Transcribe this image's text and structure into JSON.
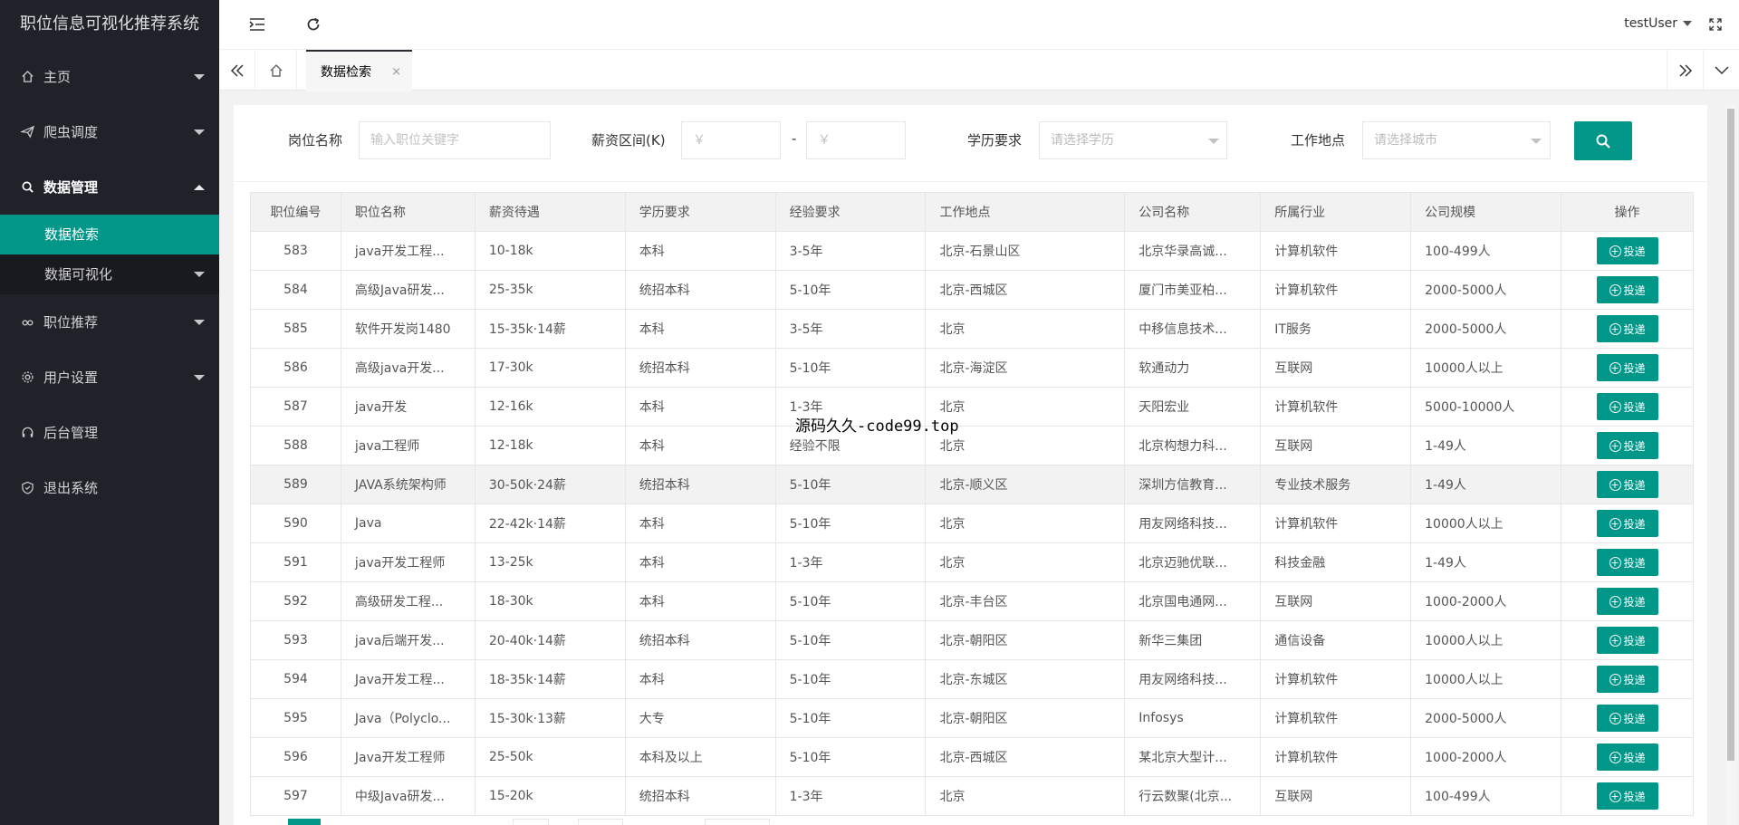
{
  "app": {
    "title": "职位信息可视化推荐系统"
  },
  "sidebar": {
    "items": [
      {
        "label": "主页",
        "icon": "home-icon"
      },
      {
        "label": "爬虫调度",
        "icon": "send-icon"
      },
      {
        "label": "数据管理",
        "icon": "search-icon",
        "open": true,
        "children": [
          {
            "label": "数据检索",
            "active": true
          },
          {
            "label": "数据可视化"
          }
        ]
      },
      {
        "label": "职位推荐",
        "icon": "link-icon"
      },
      {
        "label": "用户设置",
        "icon": "gear-icon"
      },
      {
        "label": "后台管理",
        "icon": "headset-icon"
      },
      {
        "label": "退出系统",
        "icon": "shield-icon"
      }
    ]
  },
  "header": {
    "user": "testUser"
  },
  "tabs": {
    "active_label": "数据检索",
    "close_glyph": "×"
  },
  "search": {
    "job_label": "岗位名称",
    "job_placeholder": "输入职位关键字",
    "salary_label": "薪资区间(K)",
    "salary_min_placeholder": "￥",
    "salary_max_placeholder": "￥",
    "salary_dash": "-",
    "edu_label": "学历要求",
    "edu_placeholder": "请选择学历",
    "city_label": "工作地点",
    "city_placeholder": "请选择城市"
  },
  "table": {
    "headers": [
      "职位编号",
      "职位名称",
      "薪资待遇",
      "学历要求",
      "经验要求",
      "工作地点",
      "公司名称",
      "所属行业",
      "公司规模",
      "操作"
    ],
    "action_label": "投递",
    "rows": [
      [
        "583",
        "java开发工程...",
        "10-18k",
        "本科",
        "3-5年",
        "北京-石景山区",
        "北京华录高诚...",
        "计算机软件",
        "100-499人"
      ],
      [
        "584",
        "高级Java研发...",
        "25-35k",
        "统招本科",
        "5-10年",
        "北京-西城区",
        "厦门市美亚柏...",
        "计算机软件",
        "2000-5000人"
      ],
      [
        "585",
        "软件开发岗1480",
        "15-35k·14薪",
        "本科",
        "3-5年",
        "北京",
        "中移信息技术...",
        "IT服务",
        "2000-5000人"
      ],
      [
        "586",
        "高级java开发...",
        "17-30k",
        "统招本科",
        "5-10年",
        "北京-海淀区",
        "软通动力",
        "互联网",
        "10000人以上"
      ],
      [
        "587",
        "java开发",
        "12-16k",
        "本科",
        "1-3年",
        "北京",
        "天阳宏业",
        "计算机软件",
        "5000-10000人"
      ],
      [
        "588",
        "java工程师",
        "12-18k",
        "本科",
        "经验不限",
        "北京",
        "北京构想力科...",
        "互联网",
        "1-49人"
      ],
      [
        "589",
        "JAVA系统架构师",
        "30-50k·24薪",
        "统招本科",
        "5-10年",
        "北京-顺义区",
        "深圳方信教育...",
        "专业技术服务",
        "1-49人"
      ],
      [
        "590",
        "Java",
        "22-42k·14薪",
        "本科",
        "5-10年",
        "北京",
        "用友网络科技...",
        "计算机软件",
        "10000人以上"
      ],
      [
        "591",
        "java开发工程师",
        "13-25k",
        "本科",
        "1-3年",
        "北京",
        "北京迈驰优联...",
        "科技金融",
        "1-49人"
      ],
      [
        "592",
        "高级研发工程...",
        "18-30k",
        "本科",
        "5-10年",
        "北京-丰台区",
        "北京国电通网...",
        "互联网",
        "1000-2000人"
      ],
      [
        "593",
        "java后端开发...",
        "20-40k·14薪",
        "统招本科",
        "5-10年",
        "北京-朝阳区",
        "新华三集团",
        "通信设备",
        "10000人以上"
      ],
      [
        "594",
        "Java开发工程...",
        "18-35k·14薪",
        "本科",
        "5-10年",
        "北京-东城区",
        "用友网络科技...",
        "计算机软件",
        "10000人以上"
      ],
      [
        "595",
        "Java（Polyclo...",
        "15-30k·13薪",
        "大专",
        "5-10年",
        "北京-朝阳区",
        "Infosys",
        "计算机软件",
        "2000-5000人"
      ],
      [
        "596",
        "Java开发工程师",
        "25-50k",
        "本科及以上",
        "5-10年",
        "北京-西城区",
        "某北京大型计...",
        "计算机软件",
        "1000-2000人"
      ],
      [
        "597",
        "中级Java研发...",
        "15-20k",
        "统招本科",
        "1-3年",
        "北京",
        "行云数聚(北京...",
        "互联网",
        "100-499人"
      ]
    ],
    "highlight_row": 6
  },
  "overlay_text": "源码久久-code99.top"
}
